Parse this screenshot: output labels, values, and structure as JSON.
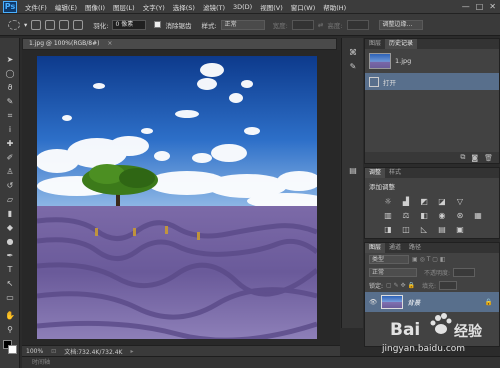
{
  "app": {
    "logo": "Ps"
  },
  "menubar": {
    "items": [
      "文件(F)",
      "编辑(E)",
      "图像(I)",
      "图层(L)",
      "文字(Y)",
      "选择(S)",
      "滤镜(T)",
      "3D(D)",
      "视图(V)",
      "窗口(W)",
      "帮助(H)"
    ],
    "window_buttons": [
      "—",
      "□",
      "✕"
    ]
  },
  "options_bar": {
    "feather_label": "羽化:",
    "feather_value": "0 像素",
    "antialias_label": "消除锯齿",
    "style_label": "样式:",
    "style_value": "正常",
    "width_label": "宽度:",
    "height_label": "高度:",
    "refine_edge": "调整边缘..."
  },
  "document": {
    "tab_title": "1.jpg @ 100%(RGB/8#)",
    "zoom": "100%",
    "doc_info": "文档:732.4K/732.4K"
  },
  "timeline": {
    "label": "时间轴"
  },
  "history_panel": {
    "tabs": [
      "图层",
      "历史记录"
    ],
    "snapshot_name": "1.jpg",
    "steps": [
      "打开"
    ]
  },
  "adjustments_panel": {
    "tabs": [
      "调整",
      "样式"
    ],
    "title": "添加调整",
    "icons": [
      "brightness-icon",
      "levels-icon",
      "curves-icon",
      "exposure-icon",
      "vibrance-icon",
      "hue-icon",
      "color-balance-icon",
      "bw-icon",
      "photo-filter-icon",
      "channel-mixer-icon",
      "lookup-icon",
      "invert-icon",
      "posterize-icon",
      "threshold-icon",
      "gradient-map-icon",
      "selective-color-icon"
    ]
  },
  "layers_panel": {
    "tabs": [
      "图层",
      "通道",
      "路径"
    ],
    "kind_label": "类型",
    "blend_mode": "正常",
    "opacity_label": "不透明度:",
    "lock_label": "锁定:",
    "fill_label": "填充:",
    "layer_name": "背景"
  },
  "watermark": {
    "brand": "Bai",
    "brand2": "经验",
    "url": "jingyan.baidu.com"
  }
}
